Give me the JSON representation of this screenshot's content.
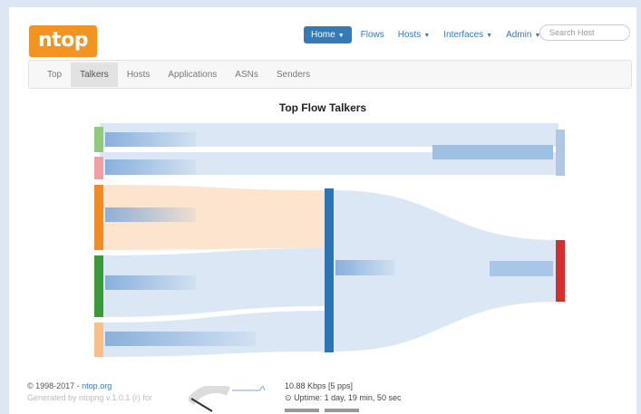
{
  "header": {
    "logo_text": "ntop",
    "nav": [
      {
        "label": "Home",
        "dropdown": true,
        "active": true
      },
      {
        "label": "Flows",
        "dropdown": false,
        "active": false
      },
      {
        "label": "Hosts",
        "dropdown": true,
        "active": false
      },
      {
        "label": "Interfaces",
        "dropdown": true,
        "active": false
      },
      {
        "label": "Admin",
        "dropdown": true,
        "active": false
      }
    ],
    "search_placeholder": "Search Host"
  },
  "tabs": [
    {
      "label": "Top",
      "active": false
    },
    {
      "label": "Talkers",
      "active": true
    },
    {
      "label": "Hosts",
      "active": false
    },
    {
      "label": "Applications",
      "active": false
    },
    {
      "label": "ASNs",
      "active": false
    },
    {
      "label": "Senders",
      "active": false
    }
  ],
  "chart_title": "Top Flow Talkers",
  "sankey": {
    "colors": {
      "green": "#8fcb7a",
      "pink": "#f0a0a0",
      "orange": "#f28b26",
      "dark_green": "#3a9a3a",
      "light_orange": "#f7c088",
      "blue": "#2c74b4",
      "light_blue": "#b0c8e6",
      "red": "#d62d2d",
      "flow_blue": "#dbe7f4",
      "flow_orange": "#fde4cf"
    }
  },
  "footer": {
    "copyright": "© 1998-2017 - ",
    "site_link": "ntop.org",
    "generated": "Generated by ntopng v.1.0.1 (r) for",
    "throughput": "10.88 Kbps [5 pps]",
    "uptime": "Uptime: 1 day, 19 min, 50 sec"
  }
}
